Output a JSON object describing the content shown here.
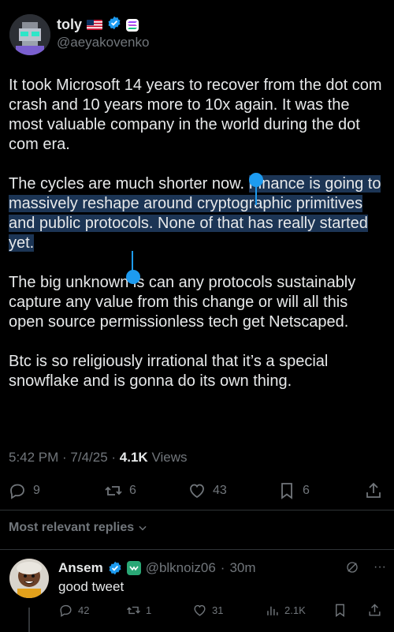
{
  "author": {
    "name": "toly",
    "handle": "@aeyakovenko"
  },
  "tweet": {
    "p1": "It took Microsoft 14 years to recover from the dot com crash and 10 years more to 10x again.  It was the most valuable company in the world during the dot com era.",
    "p2_plain": "The cycles are much shorter now.  ",
    "p2_selected": "Finance is going to massively reshape around cryptographic primitives and public protocols. None of that has really started yet.",
    "p3": "The big unknown is can any protocols sustainably capture any value from this change or will all this open source permissionless tech get Netscaped.",
    "p4": "Btc is so religiously irrational that it’s a special snowflake and is gonna do its own thing."
  },
  "meta": {
    "time": "5:42 PM",
    "sep1": " · ",
    "date": "7/4/25",
    "sep2": " · ",
    "views_count": "4.1K",
    "views_label": " Views"
  },
  "actions": {
    "replies": "9",
    "reposts": "6",
    "likes": "43",
    "bookmarks": "6"
  },
  "replies_sort": {
    "label": "Most relevant replies"
  },
  "reply": {
    "name": "Ansem",
    "handle": "@blknoiz06",
    "sep": " · ",
    "time": "30m",
    "text": "good tweet",
    "replies": "42",
    "reposts": "1",
    "likes": "31",
    "views": "2.1K",
    "more": "···"
  },
  "colors": {
    "background": "#000000",
    "text": "#e7e9ea",
    "muted": "#71767b",
    "accent": "#1d9bf0",
    "selection": "#1c3555"
  },
  "icons": [
    "verified-badge-icon",
    "us-flag-icon",
    "solana-badge-icon",
    "reply-icon",
    "repost-icon",
    "like-icon",
    "bookmark-icon",
    "share-icon",
    "chevron-down-icon",
    "grok-icon",
    "views-icon"
  ]
}
